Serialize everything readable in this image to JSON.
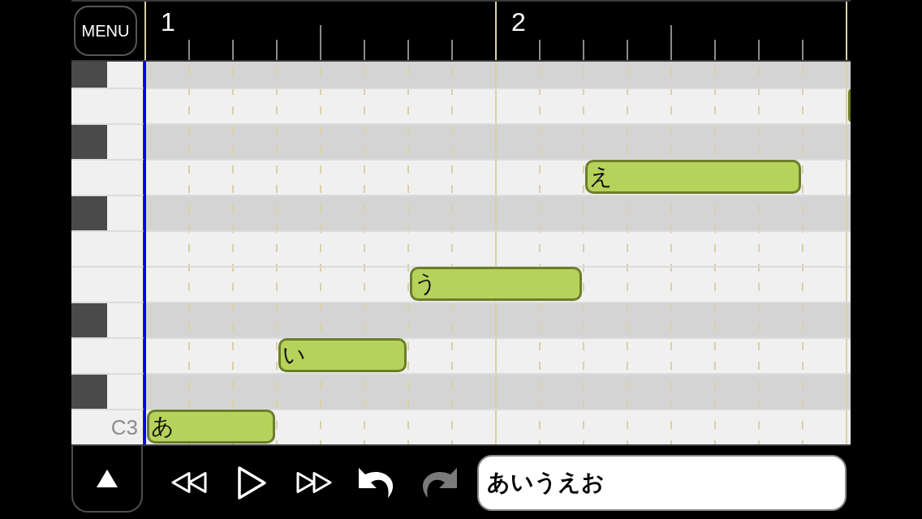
{
  "top_bar": {
    "menu_button": "MENU",
    "ruler": {
      "bars": [
        "1",
        "2"
      ]
    }
  },
  "piano_roll": {
    "rows": [
      {
        "kind": "sharp"
      },
      {
        "kind": "natural",
        "notes": [
          {
            "clipped": true
          }
        ]
      },
      {
        "kind": "sharp"
      },
      {
        "kind": "natural",
        "notes": [
          {
            "lyric": "え",
            "clipped": false
          }
        ]
      },
      {
        "kind": "sharp"
      },
      {
        "kind": "natural"
      },
      {
        "kind": "natural",
        "notes": [
          {
            "lyric": "う",
            "clipped": false
          }
        ]
      },
      {
        "kind": "sharp"
      },
      {
        "kind": "natural",
        "notes": [
          {
            "lyric": "い",
            "clipped": false
          }
        ]
      },
      {
        "kind": "sharp"
      },
      {
        "kind": "natural",
        "label": "C3",
        "notes": [
          {
            "lyric": "あ",
            "clipped": false
          }
        ]
      }
    ]
  },
  "toolbar": {
    "buttons": [
      {
        "kind": "panel_toggle",
        "disabled": false
      },
      {
        "kind": "rewind",
        "disabled": false
      },
      {
        "kind": "play",
        "disabled": false
      },
      {
        "kind": "fast_forward",
        "disabled": false
      },
      {
        "kind": "undo",
        "disabled": false
      },
      {
        "kind": "redo",
        "disabled": true
      }
    ],
    "lyrics_field": {
      "value": "あいうえお"
    }
  }
}
